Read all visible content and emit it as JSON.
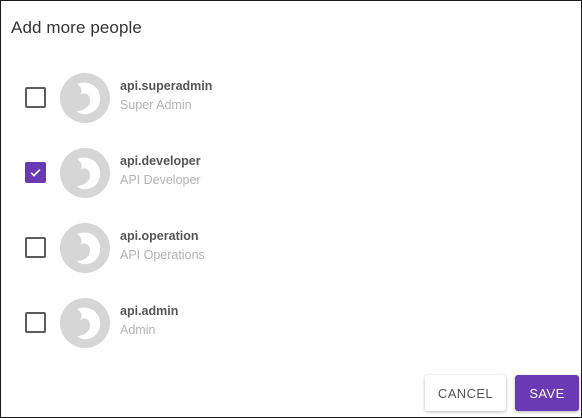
{
  "dialog": {
    "title": "Add more people"
  },
  "people": [
    {
      "name": "api.superadmin",
      "role": "Super Admin",
      "checked": false,
      "avatar_icon": "user-avatar-icon"
    },
    {
      "name": "api.developer",
      "role": "API Developer",
      "checked": true,
      "avatar_icon": "user-avatar-icon"
    },
    {
      "name": "api.operation",
      "role": "API Operations",
      "checked": false,
      "avatar_icon": "user-avatar-icon"
    },
    {
      "name": "api.admin",
      "role": "Admin",
      "checked": false,
      "avatar_icon": "user-avatar-icon"
    }
  ],
  "actions": {
    "cancel_label": "CANCEL",
    "save_label": "SAVE"
  },
  "colors": {
    "accent": "#6a3ab4",
    "avatar_bg": "#d6d6d6",
    "avatar_fg": "#ffffff",
    "checkbox_border": "#5c5c5c"
  }
}
